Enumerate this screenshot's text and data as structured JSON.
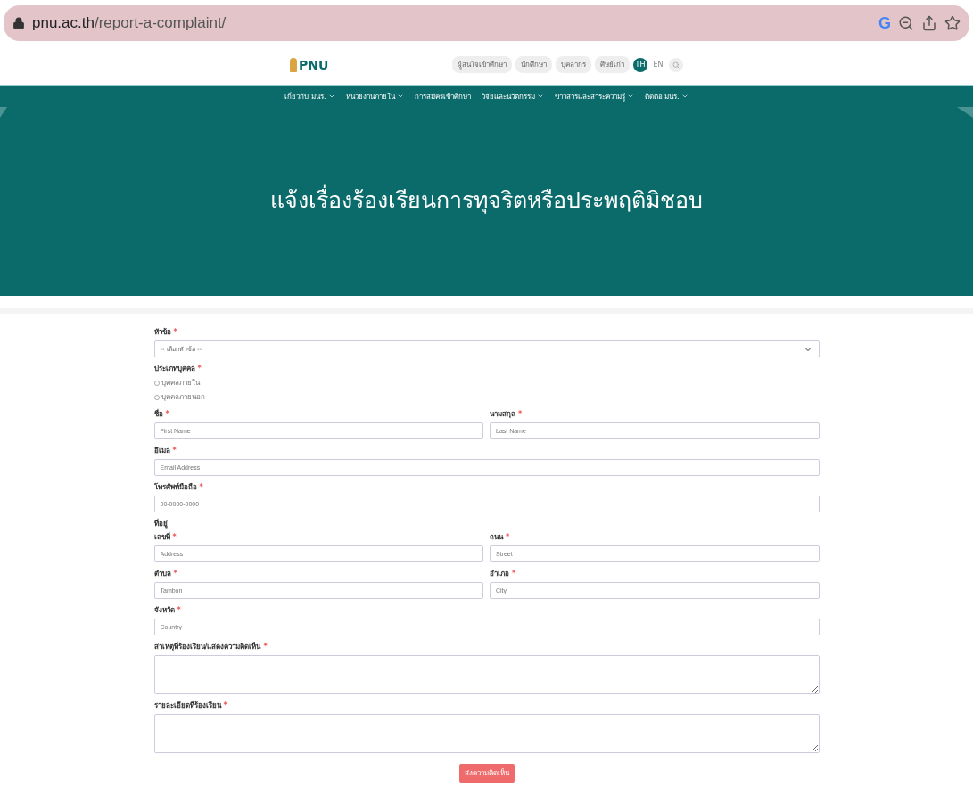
{
  "browser": {
    "url_host": "pnu.ac.th",
    "url_path": "/report-a-complaint/",
    "google_letter": "G"
  },
  "header": {
    "logo_text": "PNU",
    "links": [
      "ผู้สนใจเข้าศึกษา",
      "นักศึกษา",
      "บุคลากร",
      "ศิษย์เก่า"
    ],
    "languages": [
      {
        "label": "TH",
        "selected": true
      },
      {
        "label": "EN",
        "selected": false
      }
    ]
  },
  "nav": [
    {
      "label": "เกี่ยวกับ มนร.",
      "dropdown": true
    },
    {
      "label": "หน่วยงานภายใน",
      "dropdown": true
    },
    {
      "label": "การสมัครเข้าศึกษา",
      "dropdown": false
    },
    {
      "label": "วิจัยและนวัตกรรม",
      "dropdown": true
    },
    {
      "label": "ข่าวสารและสาระความรู้",
      "dropdown": true
    },
    {
      "label": "ติดต่อ มนร.",
      "dropdown": true
    }
  ],
  "hero": {
    "title": "แจ้งเรื่องร้องเรียนการทุจริตหรือประพฤติมิชอบ"
  },
  "form": {
    "items": [
      {
        "kind": "select",
        "label": "หัวข้อ",
        "required_mark": "*",
        "value": "-- เลือกหัวข้อ --"
      },
      {
        "kind": "radio",
        "label": "ประเภทบุคคล",
        "required_mark": "*",
        "options": [
          {
            "label": "บุคคลภายใน",
            "selected": false
          },
          {
            "label": "บุคคลภายนอก",
            "selected": false
          }
        ]
      },
      {
        "kind": "pair",
        "fields": [
          {
            "label": "ชื่อ",
            "required_mark": "*",
            "placeholder": "First Name"
          },
          {
            "label": "นามสกุล",
            "required_mark": "*",
            "placeholder": "Last Name"
          }
        ]
      },
      {
        "kind": "text",
        "label": "อีเมล",
        "required_mark": "*",
        "placeholder": "Email Address"
      },
      {
        "kind": "text",
        "label": "โทรศัพท์มือถือ",
        "required_mark": "*",
        "placeholder": "00-0000-0000"
      },
      {
        "kind": "heading",
        "label": "ที่อยู่"
      },
      {
        "kind": "pair",
        "fields": [
          {
            "label": "เลขที่",
            "required_mark": "*",
            "placeholder": "Address"
          },
          {
            "label": "ถนน",
            "required_mark": "*",
            "placeholder": "Street"
          }
        ]
      },
      {
        "kind": "pair",
        "fields": [
          {
            "label": "ตำบล",
            "required_mark": "*",
            "placeholder": "Tambon"
          },
          {
            "label": "อำเภอ",
            "required_mark": "*",
            "placeholder": "City"
          }
        ]
      },
      {
        "kind": "text",
        "label": "จังหวัด",
        "required_mark": "*",
        "placeholder": "Country"
      },
      {
        "kind": "textarea",
        "label": "สาเหตุที่ร้องเรียน/แสดงความคิดเห็น",
        "required_mark": "*"
      },
      {
        "kind": "textarea",
        "label": "รายละเอียดที่ร้องเรียน",
        "required_mark": "*"
      }
    ],
    "submit": "ส่งความคิดเห็น"
  }
}
